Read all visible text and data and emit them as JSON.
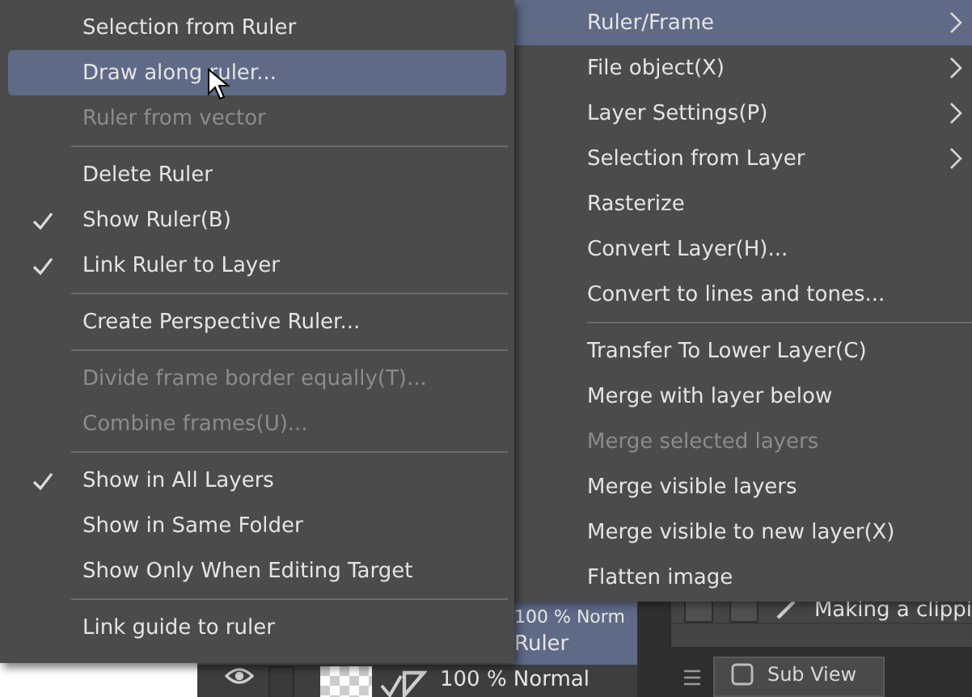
{
  "background_app": {
    "layers": [
      {
        "blend": "100 % Norm",
        "name": "Ruler",
        "selected": true
      },
      {
        "blend": "100 % Normal",
        "selected": false,
        "visible": true
      }
    ],
    "panel_row": {
      "label": "Making a clippi",
      "checks": [
        false,
        false
      ]
    },
    "tab": {
      "label": "Sub View"
    }
  },
  "left_menu": {
    "items": [
      {
        "kind": "item",
        "label": "Selection from Ruler",
        "checked": false,
        "disabled": false,
        "selected": false
      },
      {
        "kind": "item",
        "label": "Draw along ruler...",
        "checked": false,
        "disabled": false,
        "selected": true
      },
      {
        "kind": "item",
        "label": "Ruler from vector",
        "checked": false,
        "disabled": true,
        "selected": false
      },
      {
        "kind": "separator"
      },
      {
        "kind": "item",
        "label": "Delete Ruler",
        "checked": false,
        "disabled": false,
        "selected": false
      },
      {
        "kind": "item",
        "label": "Show Ruler(B)",
        "checked": true,
        "disabled": false,
        "selected": false
      },
      {
        "kind": "item",
        "label": "Link Ruler to Layer",
        "checked": true,
        "disabled": false,
        "selected": false
      },
      {
        "kind": "separator"
      },
      {
        "kind": "item",
        "label": "Create Perspective Ruler...",
        "checked": false,
        "disabled": false,
        "selected": false
      },
      {
        "kind": "separator"
      },
      {
        "kind": "item",
        "label": "Divide frame border equally(T)...",
        "checked": false,
        "disabled": true,
        "selected": false
      },
      {
        "kind": "item",
        "label": "Combine frames(U)...",
        "checked": false,
        "disabled": true,
        "selected": false
      },
      {
        "kind": "separator"
      },
      {
        "kind": "item",
        "label": "Show in All Layers",
        "checked": true,
        "disabled": false,
        "selected": false
      },
      {
        "kind": "item",
        "label": "Show in Same Folder",
        "checked": false,
        "disabled": false,
        "selected": false
      },
      {
        "kind": "item",
        "label": "Show Only When Editing Target",
        "checked": false,
        "disabled": false,
        "selected": false
      },
      {
        "kind": "separator"
      },
      {
        "kind": "item",
        "label": "Link guide to ruler",
        "checked": false,
        "disabled": false,
        "selected": false
      }
    ]
  },
  "right_menu": {
    "items": [
      {
        "kind": "item",
        "label": "Ruler/Frame",
        "submenu": true,
        "disabled": false,
        "selected": true
      },
      {
        "kind": "item",
        "label": "File object(X)",
        "submenu": true,
        "disabled": false,
        "selected": false
      },
      {
        "kind": "item",
        "label": "Layer Settings(P)",
        "submenu": true,
        "disabled": false,
        "selected": false
      },
      {
        "kind": "item",
        "label": "Selection from Layer",
        "submenu": true,
        "disabled": false,
        "selected": false
      },
      {
        "kind": "item",
        "label": "Rasterize",
        "submenu": false,
        "disabled": false,
        "selected": false
      },
      {
        "kind": "item",
        "label": "Convert Layer(H)...",
        "submenu": false,
        "disabled": false,
        "selected": false
      },
      {
        "kind": "item",
        "label": "Convert to lines and tones...",
        "submenu": false,
        "disabled": false,
        "selected": false
      },
      {
        "kind": "separator"
      },
      {
        "kind": "item",
        "label": "Transfer To Lower Layer(C)",
        "submenu": false,
        "disabled": false,
        "selected": false
      },
      {
        "kind": "item",
        "label": "Merge with layer below",
        "submenu": false,
        "disabled": false,
        "selected": false
      },
      {
        "kind": "item",
        "label": "Merge selected layers",
        "submenu": false,
        "disabled": true,
        "selected": false
      },
      {
        "kind": "item",
        "label": "Merge visible layers",
        "submenu": false,
        "disabled": false,
        "selected": false
      },
      {
        "kind": "item",
        "label": "Merge visible to new layer(X)",
        "submenu": false,
        "disabled": false,
        "selected": false
      },
      {
        "kind": "item",
        "label": "Flatten image",
        "submenu": false,
        "disabled": false,
        "selected": false
      }
    ]
  }
}
